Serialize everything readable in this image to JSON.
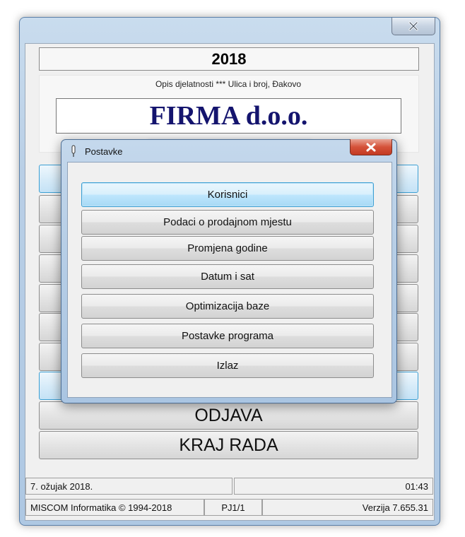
{
  "main_window": {
    "year": "2018",
    "company_description": "Opis djelatnosti *** Ulica i broj, Đakovo",
    "company_name": "FIRMA d.o.o.",
    "buttons": {
      "logout": "ODJAVA",
      "exit": "KRAJ RADA"
    },
    "status": {
      "date": "7. ožujak 2018.",
      "time": "01:43",
      "vendor": "MISCOM Informatika © 1994-2018",
      "register": "PJ1/1",
      "version": "Verzija 7.655.31"
    }
  },
  "dialog": {
    "title": "Postavke",
    "items": [
      {
        "label": "Korisnici"
      },
      {
        "label": "Podaci o prodajnom mjestu"
      },
      {
        "label": "Promjena godine"
      },
      {
        "label": "Datum i sat"
      },
      {
        "label": "Optimizacija baze"
      },
      {
        "label": "Postavke programa"
      },
      {
        "label": "Izlaz"
      }
    ]
  },
  "icons": {
    "window_close": "close-icon",
    "dialog_app": "pin-icon"
  },
  "colors": {
    "company_name": "#14146e",
    "active_border": "#3c9fd3",
    "dialog_close": "#c33b22"
  }
}
